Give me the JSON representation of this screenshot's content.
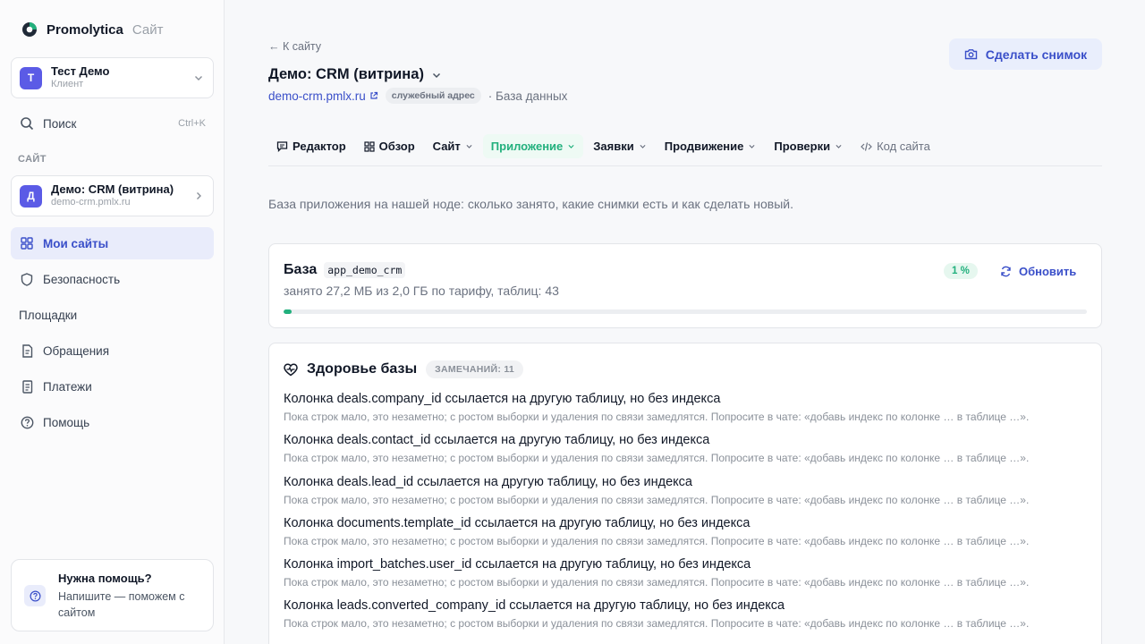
{
  "brand": {
    "name": "Promolytica",
    "suffix": "Сайт"
  },
  "account": {
    "initial": "Т",
    "name": "Тест Демо",
    "role": "Клиент"
  },
  "search": {
    "label": "Поиск",
    "shortcut": "Ctrl+K"
  },
  "sidebar": {
    "section_label": "САЙТ",
    "site": {
      "initial": "Д",
      "name": "Демо: CRM (витрина)",
      "domain": "demo-crm.pmlx.ru"
    },
    "items": [
      {
        "label": "Мои сайты",
        "icon": "grid-icon"
      },
      {
        "label": "Безопасность",
        "icon": "shield-icon"
      },
      {
        "label": "Площадки"
      },
      {
        "label": "Обращения",
        "icon": "doc-icon"
      },
      {
        "label": "Платежи",
        "icon": "receipt-icon"
      },
      {
        "label": "Помощь",
        "icon": "help-icon"
      }
    ],
    "help": {
      "title": "Нужна помощь?",
      "text": "Напишите — поможем с сайтом"
    }
  },
  "header": {
    "back": "К сайту",
    "title": "Демо: CRM (витрина)",
    "url": "demo-crm.pmlx.ru",
    "tag": "служебный адрес",
    "db_label": "· База данных",
    "snapshot_button": "Сделать снимок"
  },
  "tabs": [
    {
      "label": "Редактор"
    },
    {
      "label": "Обзор"
    },
    {
      "label": "Сайт"
    },
    {
      "label": "Приложение"
    },
    {
      "label": "Заявки"
    },
    {
      "label": "Продвижение"
    },
    {
      "label": "Проверки"
    },
    {
      "label": "Код сайта"
    }
  ],
  "description": "База приложения на нашей ноде: сколько занято, какие снимки есть и как сделать новый.",
  "database": {
    "label": "База",
    "name": "app_demo_crm",
    "usage": "занято 27,2 МБ из 2,0 ГБ по тарифу, таблиц: 43",
    "percent_label": "1 %",
    "percent": 1,
    "refresh": "Обновить",
    "accent": "#22b07d"
  },
  "health": {
    "title": "Здоровье базы",
    "badge": "ЗАМЕЧАНИЙ: 11",
    "issues": [
      {
        "title": "Колонка deals.company_id ссылается на другую таблицу, но без индекса",
        "hint": "Пока строк мало, это незаметно; с ростом выборки и удаления по связи замедлятся. Попросите в чате: «добавь индекс по колонке … в таблице …»."
      },
      {
        "title": "Колонка deals.contact_id ссылается на другую таблицу, но без индекса",
        "hint": "Пока строк мало, это незаметно; с ростом выборки и удаления по связи замедлятся. Попросите в чате: «добавь индекс по колонке … в таблице …»."
      },
      {
        "title": "Колонка deals.lead_id ссылается на другую таблицу, но без индекса",
        "hint": "Пока строк мало, это незаметно; с ростом выборки и удаления по связи замедлятся. Попросите в чате: «добавь индекс по колонке … в таблице …»."
      },
      {
        "title": "Колонка documents.template_id ссылается на другую таблицу, но без индекса",
        "hint": "Пока строк мало, это незаметно; с ростом выборки и удаления по связи замедлятся. Попросите в чате: «добавь индекс по колонке … в таблице …»."
      },
      {
        "title": "Колонка import_batches.user_id ссылается на другую таблицу, но без индекса",
        "hint": "Пока строк мало, это незаметно; с ростом выборки и удаления по связи замедлятся. Попросите в чате: «добавь индекс по колонке … в таблице …»."
      },
      {
        "title": "Колонка leads.converted_company_id ссылается на другую таблицу, но без индекса",
        "hint": "Пока строк мало, это незаметно; с ростом выборки и удаления по связи замедлятся. Попросите в чате: «добавь индекс по колонке … в таблице …»."
      }
    ]
  }
}
